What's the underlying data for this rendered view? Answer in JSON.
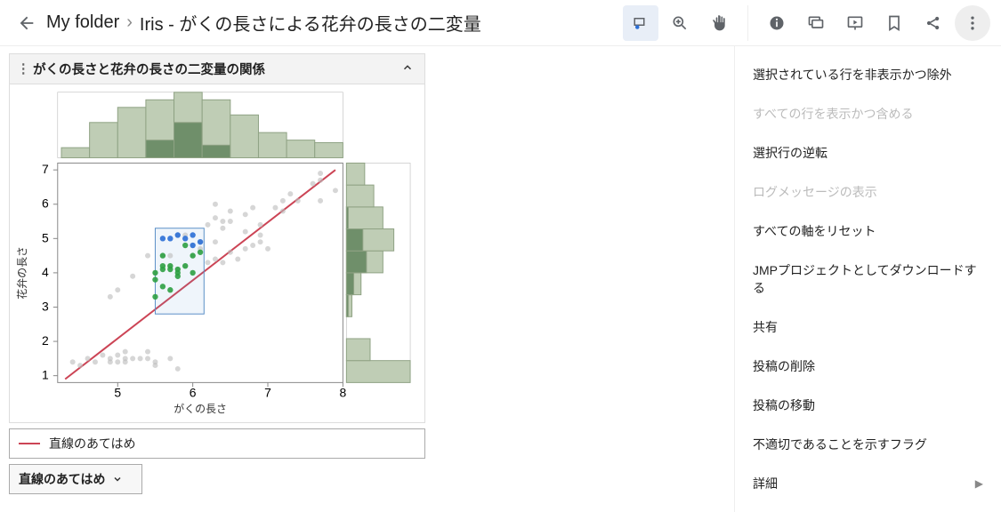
{
  "header": {
    "breadcrumb_root": "My folder",
    "breadcrumb_sep": "›",
    "breadcrumb_page": "Iris - がくの長さによる花弁の長さの二変量"
  },
  "toolbar": {
    "buttons": [
      "selection-tool",
      "zoom-tool",
      "pan-tool"
    ],
    "right_buttons": [
      "info",
      "comment",
      "slideshow",
      "bookmark",
      "share",
      "overflow"
    ]
  },
  "panel": {
    "title": "がくの長さと花弁の長さの二変量の関係"
  },
  "legend": {
    "fit_label": "直線のあてはめ"
  },
  "dropdown": {
    "label": "直線のあてはめ"
  },
  "chart_data": {
    "type": "scatter",
    "xlabel": "がくの長さ",
    "ylabel": "花弁の長さ",
    "xlim": [
      4.2,
      8.0
    ],
    "ylim": [
      0.8,
      7.2
    ],
    "x_ticks": [
      5,
      6,
      7,
      8
    ],
    "y_ticks": [
      1,
      2,
      3,
      4,
      5,
      6,
      7
    ],
    "selection_rect": {
      "x0": 5.5,
      "x1": 6.15,
      "y0": 2.8,
      "y1": 5.3
    },
    "points_grey": [
      [
        4.4,
        1.4
      ],
      [
        4.5,
        1.3
      ],
      [
        4.6,
        1.5
      ],
      [
        4.7,
        1.4
      ],
      [
        4.8,
        1.6
      ],
      [
        4.9,
        1.5
      ],
      [
        4.9,
        1.4
      ],
      [
        5.0,
        1.4
      ],
      [
        5.0,
        1.6
      ],
      [
        5.1,
        1.5
      ],
      [
        5.1,
        1.7
      ],
      [
        5.1,
        1.4
      ],
      [
        5.2,
        1.5
      ],
      [
        5.3,
        1.5
      ],
      [
        5.4,
        1.7
      ],
      [
        5.4,
        1.5
      ],
      [
        5.5,
        1.4
      ],
      [
        5.5,
        1.3
      ],
      [
        5.7,
        1.5
      ],
      [
        5.8,
        1.2
      ],
      [
        4.9,
        3.3
      ],
      [
        5.0,
        3.5
      ],
      [
        5.2,
        3.9
      ],
      [
        5.4,
        4.5
      ],
      [
        5.5,
        4.0
      ],
      [
        5.6,
        4.5
      ],
      [
        5.7,
        4.2
      ],
      [
        5.7,
        4.5
      ],
      [
        5.8,
        4.1
      ],
      [
        5.9,
        4.2
      ],
      [
        6.0,
        4.5
      ],
      [
        6.1,
        4.7
      ],
      [
        6.2,
        4.3
      ],
      [
        6.3,
        4.4
      ],
      [
        6.3,
        4.9
      ],
      [
        6.4,
        4.3
      ],
      [
        6.5,
        4.6
      ],
      [
        6.6,
        4.4
      ],
      [
        6.7,
        4.7
      ],
      [
        6.8,
        4.8
      ],
      [
        6.9,
        4.9
      ],
      [
        7.0,
        4.7
      ],
      [
        5.8,
        5.1
      ],
      [
        5.9,
        5.1
      ],
      [
        6.0,
        4.8
      ],
      [
        6.1,
        4.9
      ],
      [
        6.2,
        5.4
      ],
      [
        6.3,
        5.6
      ],
      [
        6.3,
        6.0
      ],
      [
        6.4,
        5.3
      ],
      [
        6.4,
        5.5
      ],
      [
        6.5,
        5.8
      ],
      [
        6.5,
        5.5
      ],
      [
        6.7,
        5.7
      ],
      [
        6.7,
        5.2
      ],
      [
        6.8,
        5.9
      ],
      [
        6.9,
        5.4
      ],
      [
        6.9,
        5.1
      ],
      [
        7.1,
        5.9
      ],
      [
        7.2,
        6.1
      ],
      [
        7.2,
        5.8
      ],
      [
        7.3,
        6.3
      ],
      [
        7.4,
        6.1
      ],
      [
        7.6,
        6.6
      ],
      [
        7.7,
        6.7
      ],
      [
        7.7,
        6.9
      ],
      [
        7.7,
        6.1
      ],
      [
        7.9,
        6.4
      ]
    ],
    "points_blue": [
      [
        5.6,
        5.0
      ],
      [
        5.7,
        5.0
      ],
      [
        5.8,
        5.1
      ],
      [
        5.9,
        5.0
      ],
      [
        6.0,
        5.1
      ],
      [
        6.0,
        4.8
      ],
      [
        6.1,
        4.9
      ]
    ],
    "points_green": [
      [
        5.5,
        4.0
      ],
      [
        5.6,
        4.1
      ],
      [
        5.6,
        3.6
      ],
      [
        5.6,
        4.5
      ],
      [
        5.7,
        4.2
      ],
      [
        5.7,
        3.5
      ],
      [
        5.8,
        4.0
      ],
      [
        5.8,
        3.9
      ],
      [
        5.9,
        4.2
      ],
      [
        5.5,
        3.8
      ],
      [
        5.6,
        4.2
      ],
      [
        5.7,
        4.1
      ],
      [
        5.8,
        4.1
      ],
      [
        5.9,
        4.8
      ],
      [
        6.0,
        4.5
      ],
      [
        6.0,
        4.0
      ],
      [
        6.1,
        4.6
      ],
      [
        5.5,
        3.3
      ]
    ],
    "regression": {
      "x0": 4.3,
      "y0": 0.9,
      "x1": 7.9,
      "y1": 7.0
    },
    "top_hist": {
      "bin_edges": [
        4.25,
        4.625,
        5.0,
        5.375,
        5.75,
        6.125,
        6.5,
        6.875,
        7.25,
        7.625,
        8.0
      ],
      "counts": [
        4,
        14,
        20,
        23,
        26,
        23,
        17,
        10,
        7,
        6
      ],
      "sel_counts": [
        0,
        0,
        0,
        7,
        14,
        5,
        0,
        0,
        0,
        0
      ]
    },
    "right_hist": {
      "bin_edges": [
        0.8,
        1.44,
        2.08,
        2.72,
        3.36,
        4.0,
        4.64,
        5.28,
        5.92,
        6.56,
        7.2
      ],
      "counts": [
        35,
        13,
        0,
        3,
        8,
        20,
        26,
        20,
        15,
        10
      ],
      "sel_counts": [
        0,
        0,
        0,
        1,
        4,
        11,
        9,
        1,
        0,
        0
      ]
    }
  },
  "menu": {
    "items": [
      {
        "label": "選択されている行を非表示かつ除外",
        "disabled": false
      },
      {
        "label": "すべての行を表示かつ含める",
        "disabled": true
      },
      {
        "label": "選択行の逆転",
        "disabled": false
      },
      {
        "label": "ログメッセージの表示",
        "disabled": true
      },
      {
        "label": "すべての軸をリセット",
        "disabled": false
      },
      {
        "label": "JMPプロジェクトとしてダウンロードする",
        "disabled": false
      },
      {
        "label": "共有",
        "disabled": false
      },
      {
        "label": "投稿の削除",
        "disabled": false
      },
      {
        "label": "投稿の移動",
        "disabled": false
      },
      {
        "label": "不適切であることを示すフラグ",
        "disabled": false
      },
      {
        "label": "詳細",
        "disabled": false,
        "submenu": true
      }
    ]
  }
}
